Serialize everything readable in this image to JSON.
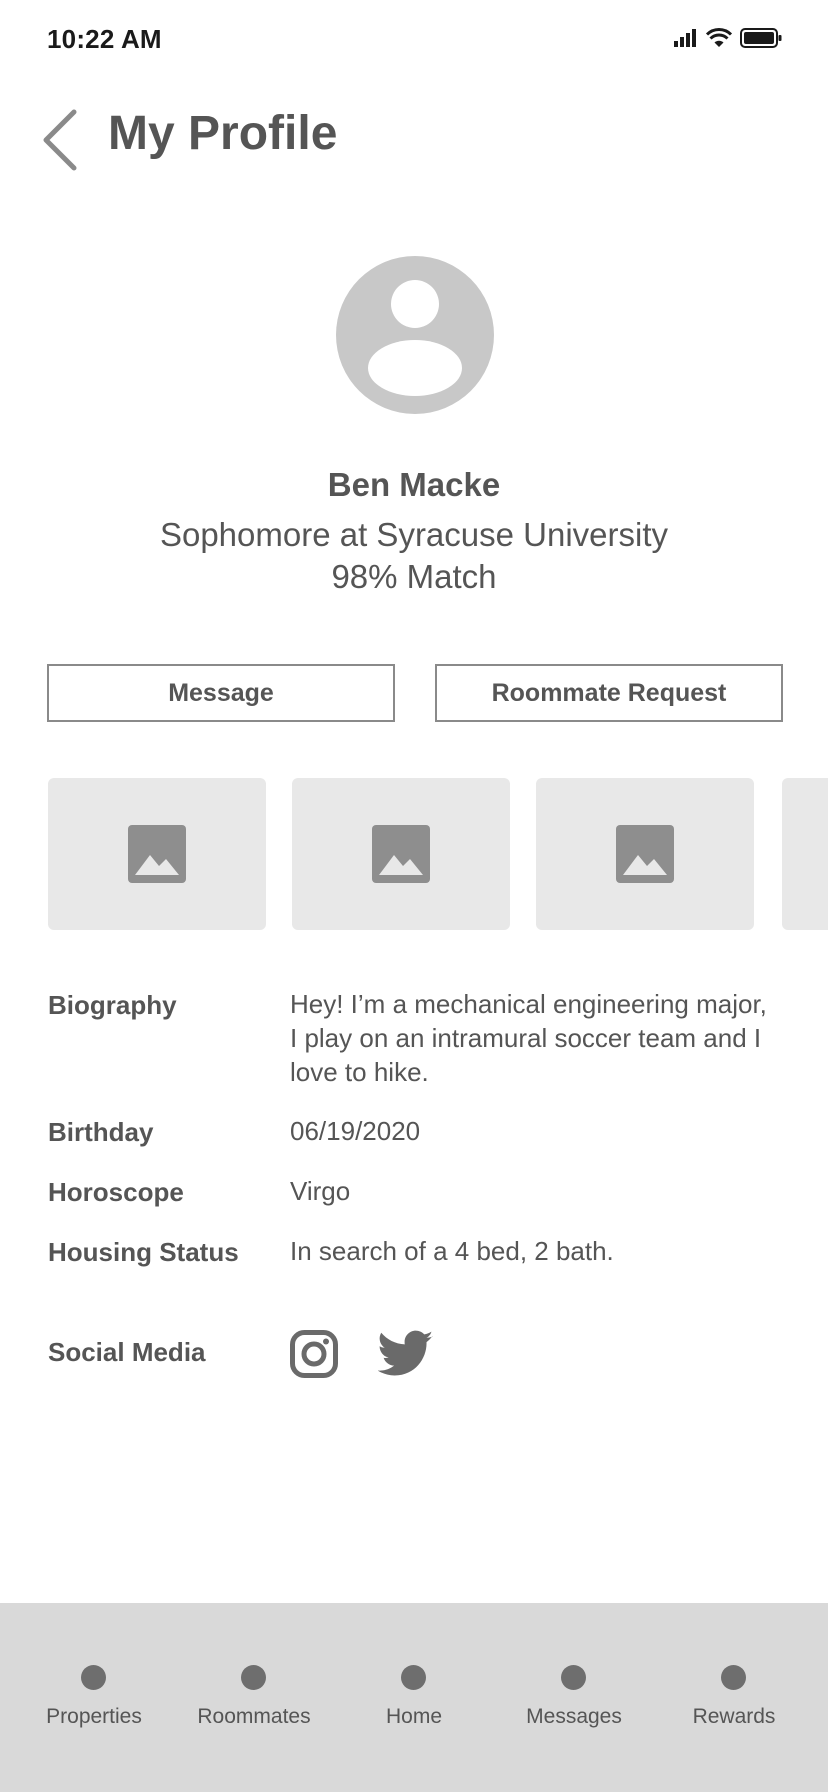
{
  "status_bar": {
    "time": "10:22 AM"
  },
  "header": {
    "title": "My Profile"
  },
  "profile": {
    "name": "Ben Macke",
    "school": "Sophomore at Syracuse University",
    "match": "98% Match"
  },
  "actions": {
    "message": "Message",
    "roommate_request": "Roommate Request"
  },
  "details": {
    "biography_label": "Biography",
    "biography_value": "Hey! I’m a mechanical engineering major, I play on an intramural soccer team and I love to hike.",
    "birthday_label": "Birthday",
    "birthday_value": "06/19/2020",
    "horoscope_label": "Horoscope",
    "horoscope_value": "Virgo",
    "housing_label": "Housing Status",
    "housing_value": "In search of a 4 bed, 2 bath.",
    "social_label": "Social Media"
  },
  "social_icons": [
    "instagram-icon",
    "twitter-icon"
  ],
  "tabs": [
    {
      "label": "Properties"
    },
    {
      "label": "Roommates"
    },
    {
      "label": "Home"
    },
    {
      "label": "Messages"
    },
    {
      "label": "Rewards"
    }
  ],
  "colors": {
    "text": "#555555",
    "placeholder": "#e8e8e8",
    "avatar": "#c8c8c8",
    "tabbar": "#d9d9d9"
  }
}
